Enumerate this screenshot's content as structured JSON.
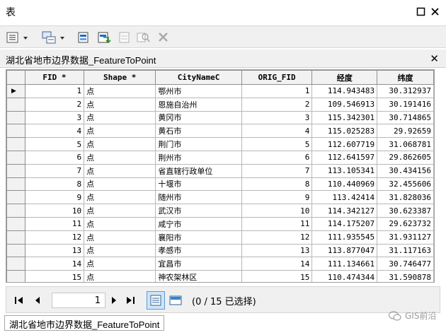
{
  "window": {
    "title": "表",
    "maximize_glyph": "☐",
    "close_glyph": "✕"
  },
  "toolbar": {
    "icons": [
      "table-options-icon",
      "related-tables-icon",
      "select-by-attributes-icon",
      "switch-selection-icon",
      "clear-selection-icon",
      "zoom-to-selected-icon",
      "delete-selected-icon"
    ]
  },
  "layer": {
    "name": "湖北省地市边界数据_FeatureToPoint",
    "close_glyph": "✕"
  },
  "table": {
    "columns": [
      "FID *",
      "Shape *",
      "CityNameC",
      "ORIG_FID",
      "经度",
      "纬度"
    ],
    "rows": [
      [
        "1",
        "点",
        "鄂州市",
        "1",
        "114.943483",
        "30.312937"
      ],
      [
        "2",
        "点",
        "恩施自治州",
        "2",
        "109.546913",
        "30.191416"
      ],
      [
        "3",
        "点",
        "黄冈市",
        "3",
        "115.342301",
        "30.714865"
      ],
      [
        "4",
        "点",
        "黄石市",
        "4",
        "115.025283",
        "29.92659"
      ],
      [
        "5",
        "点",
        "荆门市",
        "5",
        "112.607719",
        "31.068781"
      ],
      [
        "6",
        "点",
        "荆州市",
        "6",
        "112.641597",
        "29.862605"
      ],
      [
        "7",
        "点",
        "省直辖行政单位",
        "7",
        "113.105341",
        "30.434156"
      ],
      [
        "8",
        "点",
        "十堰市",
        "8",
        "110.440969",
        "32.455606"
      ],
      [
        "9",
        "点",
        "随州市",
        "9",
        "113.42414",
        "31.828036"
      ],
      [
        "10",
        "点",
        "武汉市",
        "10",
        "114.342127",
        "30.623387"
      ],
      [
        "11",
        "点",
        "咸宁市",
        "11",
        "114.175207",
        "29.623732"
      ],
      [
        "12",
        "点",
        "襄阳市",
        "12",
        "111.935545",
        "31.931127"
      ],
      [
        "13",
        "点",
        "孝感市",
        "13",
        "113.877047",
        "31.117163"
      ],
      [
        "14",
        "点",
        "宜昌市",
        "14",
        "111.134661",
        "30.746477"
      ],
      [
        "15",
        "点",
        "神农架林区",
        "15",
        "110.474344",
        "31.590878"
      ]
    ],
    "current_row_marker": "▶"
  },
  "nav": {
    "first_glyph": "I◀",
    "prev_glyph": "◀",
    "page": "1",
    "next_glyph": "▶",
    "last_glyph": "▶I",
    "status": "(0 / 15 已选择)"
  },
  "bottom_tab": {
    "label": "湖北省地市边界数据_FeatureToPoint"
  },
  "watermark": {
    "text": "GIS前沿"
  }
}
